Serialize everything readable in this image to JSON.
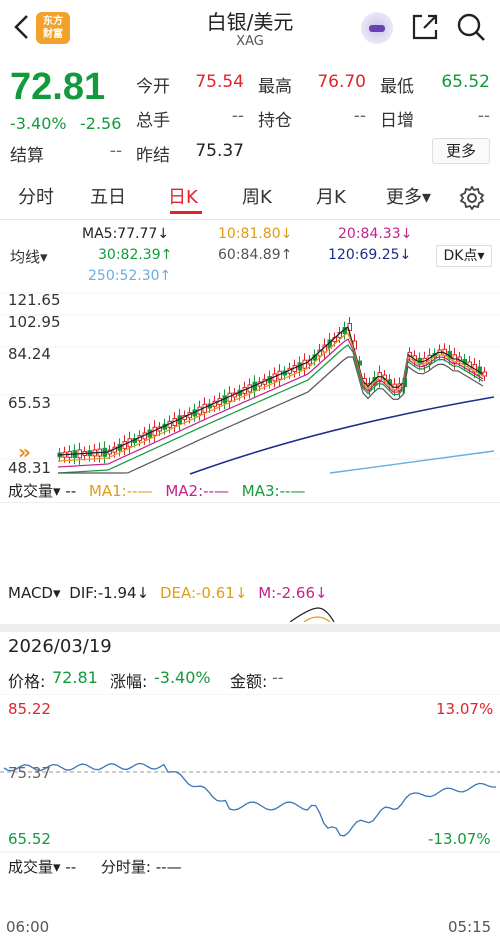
{
  "header": {
    "title": "白银/美元",
    "subtitle": "XAG",
    "logo_text": "东方\n财富"
  },
  "quote": {
    "price": "72.81",
    "change_pct": "-3.40%",
    "change": "-2.56",
    "rows": [
      {
        "label": "今开",
        "value": "75.54",
        "color": "red"
      },
      {
        "label": "最高",
        "value": "76.70",
        "color": "red"
      },
      {
        "label": "最低",
        "value": "65.52",
        "color": "green"
      },
      {
        "label": "总手",
        "value": "--",
        "color": "gray"
      },
      {
        "label": "持仓",
        "value": "--",
        "color": "gray"
      },
      {
        "label": "日增",
        "value": "--",
        "color": "gray"
      },
      {
        "label": "结算",
        "value": "--",
        "color": "gray"
      },
      {
        "label": "昨结",
        "value": "75.37",
        "color": "dark"
      }
    ],
    "more_label": "更多"
  },
  "tabs": [
    {
      "label": "分时"
    },
    {
      "label": "五日"
    },
    {
      "label": "日K"
    },
    {
      "label": "周K"
    },
    {
      "label": "月K"
    },
    {
      "label": "更多▾"
    }
  ],
  "active_tab": "日K",
  "ma_legend": {
    "select": "均线▾",
    "dk": "DK点▾",
    "items": [
      {
        "text": "MA5:77.77↓",
        "color": "#222222"
      },
      {
        "text": "10:81.80↓",
        "color": "#e39b16"
      },
      {
        "text": "20:84.33↓",
        "color": "#c2238c"
      },
      {
        "text": "30:82.39↑",
        "color": "#129a3c"
      },
      {
        "text": "60:84.89↑",
        "color": "#555555"
      },
      {
        "text": "120:69.25↓",
        "color": "#1c2d8a"
      },
      {
        "text": "250:52.30↑",
        "color": "#6aaee0"
      }
    ]
  },
  "kchart_axis": [
    "121.65",
    "102.95",
    "84.24",
    "65.53",
    "48.31"
  ],
  "volume": {
    "label": "成交量▾",
    "dash": "--",
    "ma1": "MA1:--—",
    "ma2": "MA2:--—",
    "ma3": "MA3:--—"
  },
  "macd": {
    "label": "MACD▾",
    "dif": "DIF:-1.94↓",
    "dea": "DEA:-0.61↓",
    "m": "M:-2.66↓"
  },
  "detail": {
    "date": "2026/03/19",
    "price_label": "价格:",
    "price": "72.81",
    "pct_label": "涨幅:",
    "pct": "-3.40%",
    "amount_label": "金额:",
    "amount": "--"
  },
  "intraday": {
    "high": "85.22",
    "mid": "75.37",
    "low": "65.52",
    "high_pct": "13.07%",
    "low_pct": "-13.07%",
    "vol_label": "成交量▾",
    "vol_value": "--",
    "fsl_label": "分时量:",
    "fsl_value": "--—",
    "start_time": "06:00",
    "end_time": "05:15"
  },
  "colors": {
    "up": "#e0242b",
    "down": "#129a3c",
    "line": "#3b74b8"
  }
}
